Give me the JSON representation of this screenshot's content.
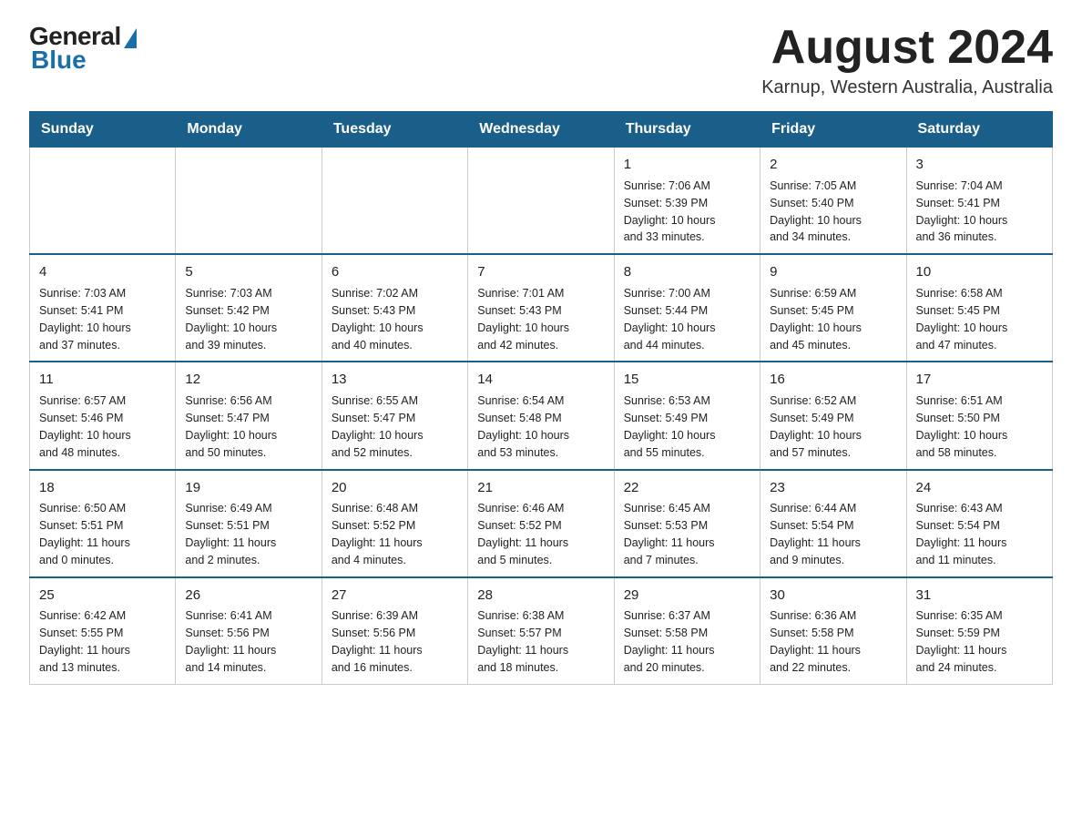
{
  "logo": {
    "general": "General",
    "blue": "Blue"
  },
  "header": {
    "month_title": "August 2024",
    "location": "Karnup, Western Australia, Australia"
  },
  "days_of_week": [
    "Sunday",
    "Monday",
    "Tuesday",
    "Wednesday",
    "Thursday",
    "Friday",
    "Saturday"
  ],
  "weeks": [
    [
      {
        "day": "",
        "info": ""
      },
      {
        "day": "",
        "info": ""
      },
      {
        "day": "",
        "info": ""
      },
      {
        "day": "",
        "info": ""
      },
      {
        "day": "1",
        "info": "Sunrise: 7:06 AM\nSunset: 5:39 PM\nDaylight: 10 hours\nand 33 minutes."
      },
      {
        "day": "2",
        "info": "Sunrise: 7:05 AM\nSunset: 5:40 PM\nDaylight: 10 hours\nand 34 minutes."
      },
      {
        "day": "3",
        "info": "Sunrise: 7:04 AM\nSunset: 5:41 PM\nDaylight: 10 hours\nand 36 minutes."
      }
    ],
    [
      {
        "day": "4",
        "info": "Sunrise: 7:03 AM\nSunset: 5:41 PM\nDaylight: 10 hours\nand 37 minutes."
      },
      {
        "day": "5",
        "info": "Sunrise: 7:03 AM\nSunset: 5:42 PM\nDaylight: 10 hours\nand 39 minutes."
      },
      {
        "day": "6",
        "info": "Sunrise: 7:02 AM\nSunset: 5:43 PM\nDaylight: 10 hours\nand 40 minutes."
      },
      {
        "day": "7",
        "info": "Sunrise: 7:01 AM\nSunset: 5:43 PM\nDaylight: 10 hours\nand 42 minutes."
      },
      {
        "day": "8",
        "info": "Sunrise: 7:00 AM\nSunset: 5:44 PM\nDaylight: 10 hours\nand 44 minutes."
      },
      {
        "day": "9",
        "info": "Sunrise: 6:59 AM\nSunset: 5:45 PM\nDaylight: 10 hours\nand 45 minutes."
      },
      {
        "day": "10",
        "info": "Sunrise: 6:58 AM\nSunset: 5:45 PM\nDaylight: 10 hours\nand 47 minutes."
      }
    ],
    [
      {
        "day": "11",
        "info": "Sunrise: 6:57 AM\nSunset: 5:46 PM\nDaylight: 10 hours\nand 48 minutes."
      },
      {
        "day": "12",
        "info": "Sunrise: 6:56 AM\nSunset: 5:47 PM\nDaylight: 10 hours\nand 50 minutes."
      },
      {
        "day": "13",
        "info": "Sunrise: 6:55 AM\nSunset: 5:47 PM\nDaylight: 10 hours\nand 52 minutes."
      },
      {
        "day": "14",
        "info": "Sunrise: 6:54 AM\nSunset: 5:48 PM\nDaylight: 10 hours\nand 53 minutes."
      },
      {
        "day": "15",
        "info": "Sunrise: 6:53 AM\nSunset: 5:49 PM\nDaylight: 10 hours\nand 55 minutes."
      },
      {
        "day": "16",
        "info": "Sunrise: 6:52 AM\nSunset: 5:49 PM\nDaylight: 10 hours\nand 57 minutes."
      },
      {
        "day": "17",
        "info": "Sunrise: 6:51 AM\nSunset: 5:50 PM\nDaylight: 10 hours\nand 58 minutes."
      }
    ],
    [
      {
        "day": "18",
        "info": "Sunrise: 6:50 AM\nSunset: 5:51 PM\nDaylight: 11 hours\nand 0 minutes."
      },
      {
        "day": "19",
        "info": "Sunrise: 6:49 AM\nSunset: 5:51 PM\nDaylight: 11 hours\nand 2 minutes."
      },
      {
        "day": "20",
        "info": "Sunrise: 6:48 AM\nSunset: 5:52 PM\nDaylight: 11 hours\nand 4 minutes."
      },
      {
        "day": "21",
        "info": "Sunrise: 6:46 AM\nSunset: 5:52 PM\nDaylight: 11 hours\nand 5 minutes."
      },
      {
        "day": "22",
        "info": "Sunrise: 6:45 AM\nSunset: 5:53 PM\nDaylight: 11 hours\nand 7 minutes."
      },
      {
        "day": "23",
        "info": "Sunrise: 6:44 AM\nSunset: 5:54 PM\nDaylight: 11 hours\nand 9 minutes."
      },
      {
        "day": "24",
        "info": "Sunrise: 6:43 AM\nSunset: 5:54 PM\nDaylight: 11 hours\nand 11 minutes."
      }
    ],
    [
      {
        "day": "25",
        "info": "Sunrise: 6:42 AM\nSunset: 5:55 PM\nDaylight: 11 hours\nand 13 minutes."
      },
      {
        "day": "26",
        "info": "Sunrise: 6:41 AM\nSunset: 5:56 PM\nDaylight: 11 hours\nand 14 minutes."
      },
      {
        "day": "27",
        "info": "Sunrise: 6:39 AM\nSunset: 5:56 PM\nDaylight: 11 hours\nand 16 minutes."
      },
      {
        "day": "28",
        "info": "Sunrise: 6:38 AM\nSunset: 5:57 PM\nDaylight: 11 hours\nand 18 minutes."
      },
      {
        "day": "29",
        "info": "Sunrise: 6:37 AM\nSunset: 5:58 PM\nDaylight: 11 hours\nand 20 minutes."
      },
      {
        "day": "30",
        "info": "Sunrise: 6:36 AM\nSunset: 5:58 PM\nDaylight: 11 hours\nand 22 minutes."
      },
      {
        "day": "31",
        "info": "Sunrise: 6:35 AM\nSunset: 5:59 PM\nDaylight: 11 hours\nand 24 minutes."
      }
    ]
  ]
}
